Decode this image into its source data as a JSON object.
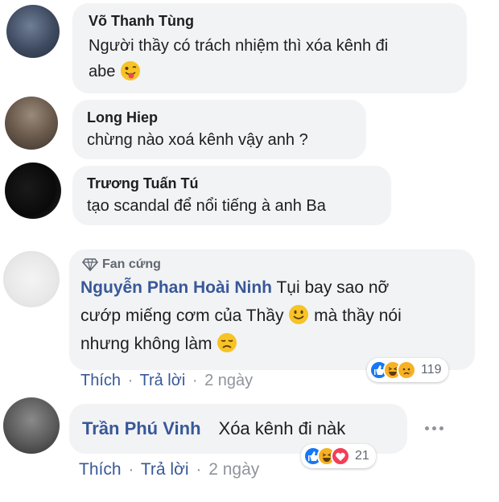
{
  "comments": [
    {
      "author": "Võ Thanh Tùng",
      "text_line1": "Người thầy có trách nhiệm thì xóa kênh đi",
      "text_line2": "abe",
      "emoji": "tongue-out-emoji"
    },
    {
      "author": "Long Hiep",
      "text": "chừng nào xoá kênh vậy anh ?"
    },
    {
      "author": "Trương Tuấn Tú",
      "text": "tạo scandal để nổi tiếng à anh Ba"
    },
    {
      "badge": "Fan cứng",
      "badge_icon": "diamond-icon",
      "author": "Nguyễn Phan Hoài Ninh",
      "text_line1": "Tụi bay sao nỡ",
      "text_line2": "cướp miếng cơm của Thầy",
      "text_line3_a": "mà thầy nói",
      "text_line3": "nhưng không làm",
      "emoji_smile": "smile-emoji",
      "emoji_sad": "disappointed-emoji",
      "actions": {
        "like": "Thích",
        "reply": "Trả lời",
        "sep": "·",
        "time": "2 ngày"
      },
      "reactions": {
        "types": [
          "like",
          "haha",
          "sad"
        ],
        "count": "119"
      }
    },
    {
      "author": "Trần Phú Vinh",
      "text": "Xóa kênh đi nàk",
      "more_icon": "more-options-icon",
      "actions": {
        "like": "Thích",
        "reply": "Trả lời",
        "sep": "·",
        "time": "2 ngày"
      },
      "reactions": {
        "types": [
          "like",
          "haha",
          "love"
        ],
        "count": "21"
      }
    }
  ],
  "colors": {
    "bubble": "#f2f3f5",
    "link": "#385898",
    "meta": "#90949c",
    "like": "#1877f2",
    "haha": "#f7b125",
    "love": "#f33e58"
  }
}
